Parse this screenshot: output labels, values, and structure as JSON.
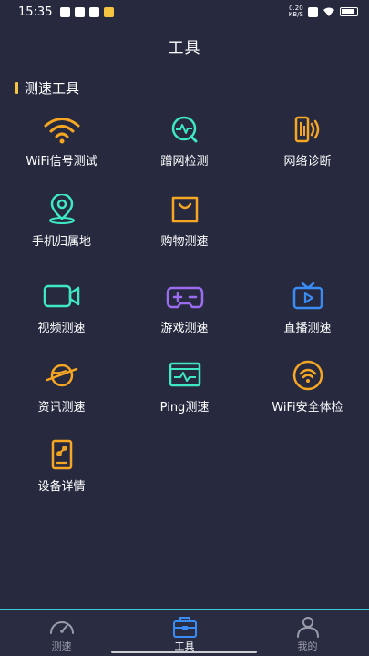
{
  "status": {
    "time": "15:35",
    "net_speed_value": "0.20",
    "net_speed_unit": "KB/S"
  },
  "header": {
    "title": "工具"
  },
  "section": {
    "title": "测速工具"
  },
  "tools": [
    {
      "label": "WiFi信号测试",
      "icon": "wifi-icon",
      "color": "#f5a623"
    },
    {
      "label": "蹭网检测",
      "icon": "network-check-icon",
      "color": "#3ee8c7"
    },
    {
      "label": "网络诊断",
      "icon": "network-diagnosis-icon",
      "color": "#f5a623"
    },
    {
      "label": "手机归属地",
      "icon": "location-pin-icon",
      "color": "#3ee8c7"
    },
    {
      "label": "购物测速",
      "icon": "shopping-bag-icon",
      "color": "#f5a623"
    },
    {
      "label": "视频测速",
      "icon": "video-camera-icon",
      "color": "#3ee8c7"
    },
    {
      "label": "游戏测速",
      "icon": "gamepad-icon",
      "color": "#9b6cf0"
    },
    {
      "label": "直播测速",
      "icon": "live-tv-icon",
      "color": "#3a8cf5"
    },
    {
      "label": "资讯测速",
      "icon": "planet-icon",
      "color": "#f5a623"
    },
    {
      "label": "Ping测速",
      "icon": "ping-monitor-icon",
      "color": "#3ee8c7"
    },
    {
      "label": "WiFi安全体检",
      "icon": "wifi-security-icon",
      "color": "#f5a623"
    },
    {
      "label": "设备详情",
      "icon": "device-phone-icon",
      "color": "#f5a623"
    }
  ],
  "tabbar": {
    "items": [
      {
        "label": "测速",
        "icon": "speedometer-icon",
        "active": false
      },
      {
        "label": "工具",
        "icon": "toolbox-icon",
        "active": true
      },
      {
        "label": "我的",
        "icon": "user-icon",
        "active": false
      }
    ],
    "active_color": "#3a8cf5"
  }
}
